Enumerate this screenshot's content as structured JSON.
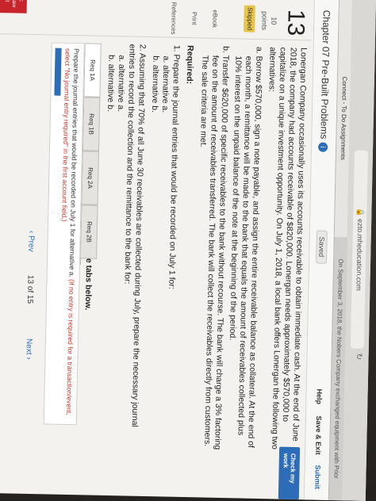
{
  "browser": {
    "url": "ezto.mheducation.com",
    "tabs": [
      "Connect - To Do Assignments",
      "On September 3, 2018, the Nobers Company exchanged equipment with Prior"
    ]
  },
  "header": {
    "title": "Chapter 07 Pre-Built Problems",
    "info_icon": "i",
    "saved_label": "Saved",
    "help_label": "Help",
    "save_exit_label": "Save & Exit",
    "submit_label": "Submit"
  },
  "sidebar": {
    "question_number": "13",
    "points_value": "10",
    "points_label": "points",
    "status_badge": "Skipped",
    "links": [
      "eBook",
      "Print",
      "References"
    ]
  },
  "check_work_label": "Check my work",
  "problem": {
    "intro": "Lonergan Company occasionally uses its accounts receivable to obtain immediate cash. At the end of June 2018, the company had accounts receivable of $820,000. Lonergan needs approximately $570,000 to capitalize on a unique investment opportunity. On July 1, 2018, a local bank offers Lonergan the following two alternatives:",
    "alt_a": "a. Borrow $570,000, sign a note payable, and assign the entire receivable balance as collateral. At the end of each month, a remittance will be made to the bank that equals the amount of receivables collected plus 10% interest on the unpaid balance of the note at the beginning of the period.",
    "alt_b": "b. Transfer $620,000 of specific receivables to the bank without recourse. The bank will charge a 3% factoring fee on the amount of receivables transferred. The bank will collect the receivables directly from customers. The sale criteria are met.",
    "required_label": "Required:",
    "req1": "1. Prepare the journal entries that would be recorded on July 1 for:",
    "req1_a": "a. alternative a.",
    "req1_b": "b. alternative b.",
    "req2": "2. Assuming that 70% of all June 30 receivables are collected during July, prepare the necessary journal entries to record the collection and the remittance to the bank for:",
    "req2_a": "a. alternative a.",
    "req2_b": "b. alternative b."
  },
  "complete_prompt": "Complete this question by entering your answers in the tabs below.",
  "req_tabs": [
    "Req 1A",
    "Req 1B",
    "Req 2A",
    "Req 2B"
  ],
  "tab_instructions": "Prepare the journal entries that would be recorded on July 1 for alternative a.",
  "tab_instructions_red": "(If no entry is required for a transaction/event, select \"No journal entry required\" in the first account field.)",
  "pager": {
    "prev_label": "Prev",
    "current": "13",
    "of_label": "of",
    "total": "15",
    "next_label": "Next"
  },
  "colors": {
    "accent": "#2d6db8",
    "skipped": "#e7c44a",
    "brand_red": "#c8242b"
  }
}
